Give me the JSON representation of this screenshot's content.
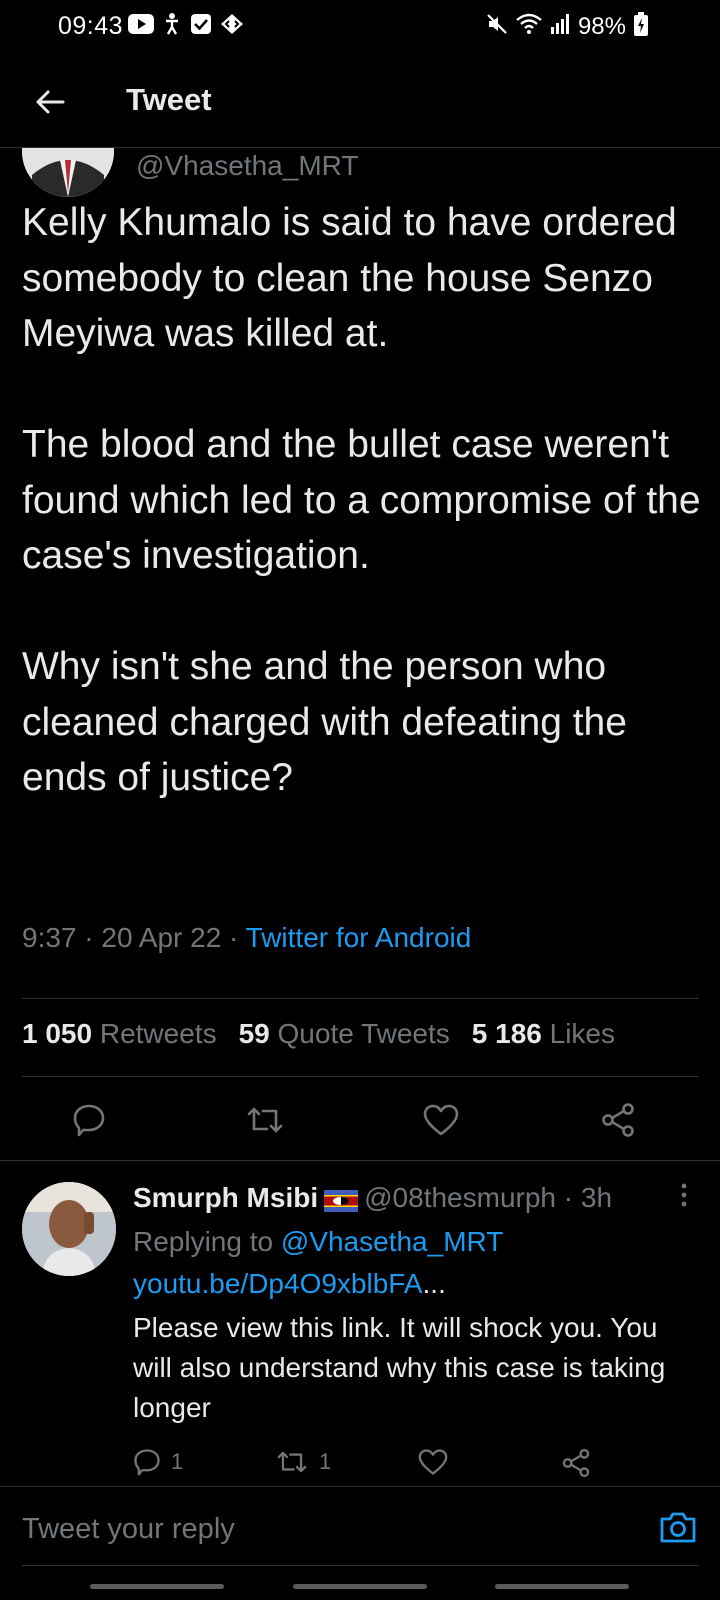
{
  "status_bar": {
    "time": "09:43",
    "left_icons": [
      "youtube-icon",
      "accessibility-icon",
      "checkbox-icon",
      "code-icon"
    ],
    "right_icons": [
      "mute-icon",
      "wifi-icon",
      "signal-icon"
    ],
    "battery": "98%"
  },
  "header": {
    "title": "Tweet"
  },
  "tweet": {
    "author_handle": "@Vhasetha_MRT",
    "text": "Kelly Khumalo is said to have ordered somebody to clean the house Senzo Meyiwa was killed at.\n\nThe blood and the bullet case weren't found which led to a compromise of the case's investigation.\n\nWhy isn't she and the person who cleaned charged with defeating the ends of justice?",
    "time": "9:37",
    "date": "20 Apr 22",
    "source": "Twitter for Android",
    "separator": " · ",
    "stats": [
      {
        "count": "1 050",
        "label": "Retweets"
      },
      {
        "count": "59",
        "label": "Quote Tweets"
      },
      {
        "count": "5 186",
        "label": "Likes"
      }
    ]
  },
  "reply": {
    "name": "Smurph Msibi",
    "handle_time": "@08thesmurph · 3h",
    "replying_prefix": "Replying to ",
    "replying_to": "@Vhasetha_MRT",
    "link": "youtu.be/Dp4O9xblbFA",
    "link_ellipsis": "...",
    "body": "Please view this link. It will shock you. You will also understand why this case is taking longer",
    "reply_count": "1",
    "retweet_count": "1"
  },
  "composer": {
    "placeholder": "Tweet your reply"
  },
  "colors": {
    "background": "#000000",
    "text": "#e7e9ea",
    "muted": "#71767b",
    "accent": "#1d9bf0",
    "divider": "#2f3336"
  }
}
